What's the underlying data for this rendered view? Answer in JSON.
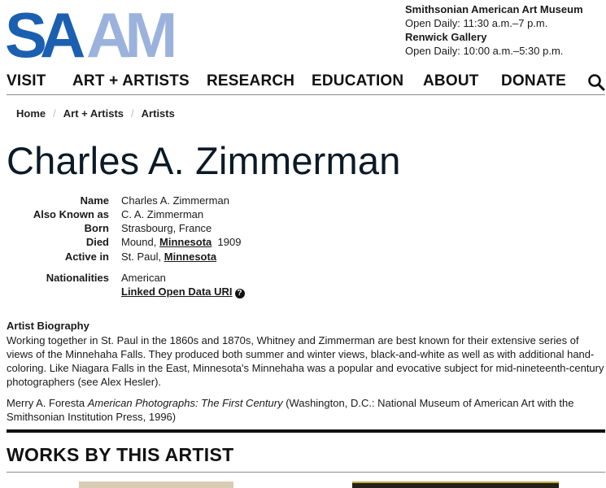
{
  "header": {
    "logo_text": "SAAM",
    "museum_name": "Smithsonian American Art Museum",
    "museum_hours": "Open Daily: 11:30 a.m.–7 p.m.",
    "gallery_name": "Renwick Gallery",
    "gallery_hours": "Open Daily: 10:00 a.m.–5:30 p.m."
  },
  "nav": {
    "items": [
      "VISIT",
      "ART + ARTISTS",
      "RESEARCH",
      "EDUCATION",
      "ABOUT",
      "DONATE"
    ],
    "search_icon": "search-icon"
  },
  "breadcrumb": [
    "Home",
    "Art + Artists",
    "Artists"
  ],
  "artist": {
    "title": "Charles A. Zimmerman",
    "facts": {
      "name_label": "Name",
      "name_value": "Charles A. Zimmerman",
      "aka_label": "Also Known as",
      "aka_value": "C. A. Zimmerman",
      "born_label": "Born",
      "born_value": "Strasbourg, France",
      "died_label": "Died",
      "died_place": "Mound,",
      "died_state": "Minnesota",
      "died_year": "1909",
      "active_label": "Active in",
      "active_place": "St. Paul,",
      "active_state": "Minnesota",
      "nationalities_label": "Nationalities",
      "nationalities_value": "American",
      "lod_link": "Linked Open Data URI",
      "lod_icon": "question-icon"
    }
  },
  "biography": {
    "heading": "Artist Biography",
    "text": "Working together in St. Paul in the 1860s and 1870s, Whitney and Zimmerman are best known for their extensive series of views of the Minnehaha Falls. They produced both summer and winter views, black-and-white as well as with additional hand-coloring. Like Niagara Falls in the East, Minnesota's Minnehaha was a popular and evocative subject for mid-nineteenth-century photographers (see Alex Hesler).",
    "citation_author": "Merry A. Foresta",
    "citation_title": "American Photographs: The First Century",
    "citation_rest": "(Washington, D.C.: National Museum of American Art with the Smithsonian Institution Press, 1996)"
  },
  "works": {
    "heading": "WORKS BY THIS ARTIST"
  },
  "colors": {
    "logo_dark": "#1b5fb0",
    "logo_light": "#8aa6d6",
    "text": "#1a1a1a"
  }
}
